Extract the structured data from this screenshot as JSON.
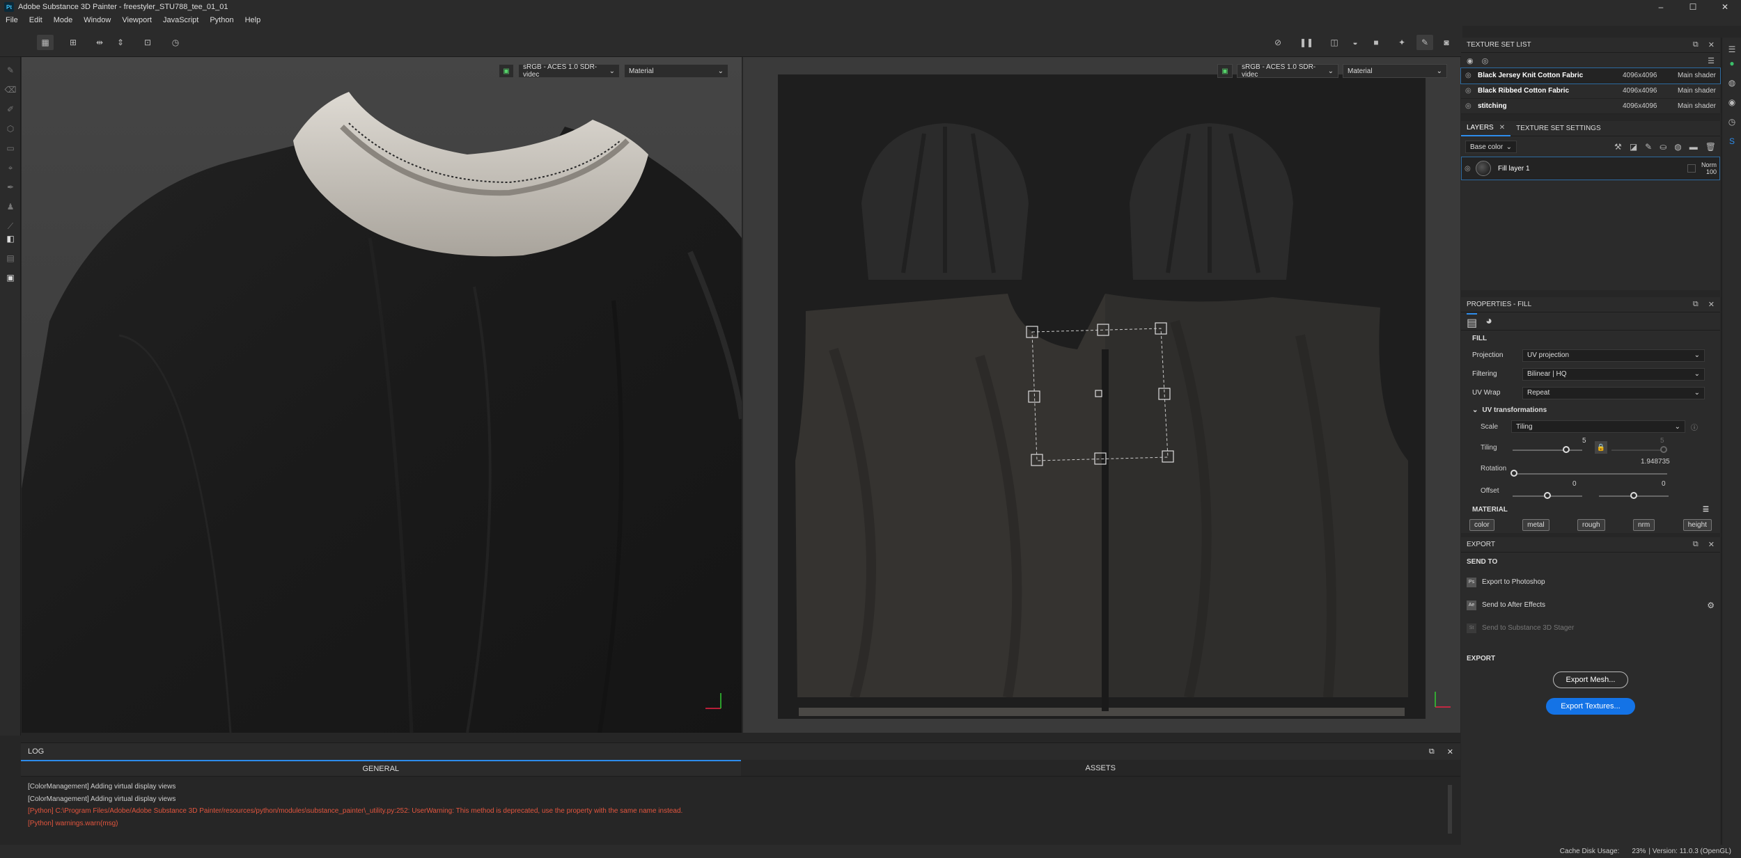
{
  "app": {
    "title": "Adobe Substance 3D Painter - freestyler_STU788_tee_01_01",
    "icon_text": "Pt",
    "window_buttons": [
      "–",
      "☐",
      "✕"
    ]
  },
  "menu": [
    "File",
    "Edit",
    "Mode",
    "Window",
    "Viewport",
    "JavaScript",
    "Python",
    "Help"
  ],
  "viewport3d": {
    "color_dropdown": "sRGB - ACES 1.0 SDR-videc",
    "mode_dropdown": "Material"
  },
  "viewport2d": {
    "color_dropdown": "sRGB - ACES 1.0 SDR-videc",
    "mode_dropdown": "Material"
  },
  "log": {
    "title": "LOG",
    "tabs": [
      "GENERAL",
      "ASSETS"
    ],
    "lines": [
      {
        "text": "[ColorManagement] Adding virtual display views",
        "level": "info"
      },
      {
        "text": "[ColorManagement] Adding virtual display views",
        "level": "info"
      },
      {
        "text": "[Python] C:\\Program Files/Adobe/Adobe Substance 3D Painter/resources/python/modules\\substance_painter\\_utility.py:252: UserWarning: This method is deprecated, use the property with the same name instead.",
        "level": "warning"
      },
      {
        "text": "[Python]    warnings.warn(msg)",
        "level": "warning"
      }
    ]
  },
  "texture_set_list": {
    "title": "TEXTURE SET LIST",
    "rows": [
      {
        "name": "Black Jersey Knit Cotton Fabric",
        "resolution": "4096x4096",
        "shader": "Main shader"
      },
      {
        "name": "Black Ribbed Cotton Fabric",
        "resolution": "4096x4096",
        "shader": "Main shader"
      },
      {
        "name": "stitching",
        "resolution": "4096x4096",
        "shader": "Main shader"
      }
    ]
  },
  "layers": {
    "tabs": [
      "LAYERS",
      "TEXTURE SET SETTINGS"
    ],
    "channel_dropdown": "Base color",
    "items": [
      {
        "name": "Fill layer 1",
        "blend": "Norm",
        "opacity": "100"
      }
    ]
  },
  "properties": {
    "title": "PROPERTIES - FILL",
    "section_fill": "FILL",
    "projection_label": "Projection",
    "projection_value": "UV projection",
    "filtering_label": "Filtering",
    "filtering_value": "Bilinear | HQ",
    "uvwrap_label": "UV Wrap",
    "uvwrap_value": "Repeat",
    "uv_transform_label": "UV transformations",
    "scale_label": "Scale",
    "scale_value": "Tiling",
    "tiling_label": "Tiling",
    "tiling_value": "5",
    "tiling_value2": "5",
    "rotation_label": "Rotation",
    "rotation_value": "1.948735",
    "offset_label": "Offset",
    "offset_x": "0",
    "offset_y": "0",
    "material_label": "MATERIAL",
    "material_channels": [
      "color",
      "metal",
      "rough",
      "nrm",
      "height"
    ]
  },
  "export": {
    "title": "EXPORT",
    "send_to_label": "SEND TO",
    "targets": [
      {
        "label": "Export to Photoshop",
        "icon": "Ps",
        "enabled": true
      },
      {
        "label": "Send to After Effects",
        "icon": "Ae",
        "enabled": true
      },
      {
        "label": "Send to Substance 3D Stager",
        "icon": "St",
        "enabled": false
      }
    ],
    "export_label": "EXPORT",
    "export_mesh": "Export Mesh...",
    "export_textures": "Export Textures..."
  },
  "status": {
    "cache_disk_usage_label": "Cache Disk Usage:",
    "cache_disk_usage_value": "23%",
    "version": "| Version: 11.0.3 (OpenGL)"
  },
  "colors": {
    "accent": "#2d8ceb",
    "warning": "#e2553e",
    "export_button": "#1473e6"
  }
}
